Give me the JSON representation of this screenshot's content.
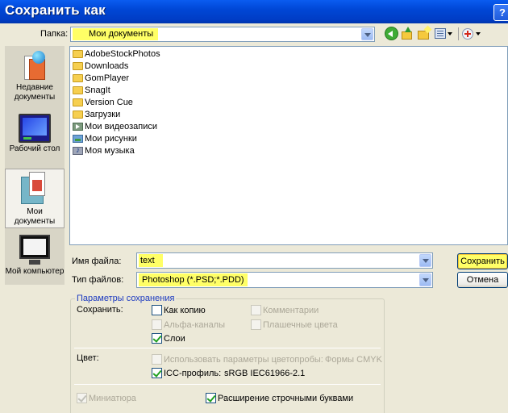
{
  "window": {
    "title": "Сохранить как",
    "help_glyph": "?"
  },
  "toolbar": {
    "folder_label": "Папка:",
    "current_folder": "Мои документы",
    "icons": [
      "back-icon",
      "up-folder-icon",
      "new-folder-icon",
      "views-menu-icon",
      "tools-menu-icon"
    ]
  },
  "places": [
    {
      "label": "Недавние документы",
      "icon": "recent-documents-icon"
    },
    {
      "label": "Рабочий стол",
      "icon": "desktop-icon"
    },
    {
      "label": "Мои документы",
      "icon": "my-documents-icon",
      "selected": true
    },
    {
      "label": "Мой компьютер",
      "icon": "my-computer-icon"
    }
  ],
  "files": [
    {
      "name": "AdobeStockPhotos",
      "icon": "folder-icon"
    },
    {
      "name": "Downloads",
      "icon": "folder-icon"
    },
    {
      "name": "GomPlayer",
      "icon": "folder-icon"
    },
    {
      "name": "SnagIt",
      "icon": "folder-icon"
    },
    {
      "name": "Version Cue",
      "icon": "folder-icon"
    },
    {
      "name": "Загрузки",
      "icon": "folder-icon"
    },
    {
      "name": "Мои видеозаписи",
      "icon": "videos-folder-icon"
    },
    {
      "name": "Мои рисунки",
      "icon": "pictures-folder-icon"
    },
    {
      "name": "Моя музыка",
      "icon": "music-folder-icon"
    }
  ],
  "form": {
    "filename_label": "Имя файла:",
    "filename_value": "text",
    "filetype_label": "Тип файлов:",
    "filetype_value": "Photoshop (*.PSD;*.PDD)",
    "save_button": "Сохранить",
    "cancel_button": "Отмена"
  },
  "options": {
    "group_title": "Параметры сохранения",
    "save_label": "Сохранить:",
    "as_copy": {
      "label": "Как копию",
      "checked": false,
      "enabled": true
    },
    "comments": {
      "label": "Комментарии",
      "checked": false,
      "enabled": false
    },
    "alpha_channels": {
      "label": "Альфа-каналы",
      "checked": false,
      "enabled": false
    },
    "spot_colors": {
      "label": "Плашечные цвета",
      "checked": false,
      "enabled": false
    },
    "layers": {
      "label": "Слои",
      "checked": true,
      "enabled": true
    },
    "color_label": "Цвет:",
    "use_proof_setup": {
      "label": "Использовать параметры цветопробы:",
      "value": "Формы CMYK",
      "checked": false,
      "enabled": false
    },
    "icc_profile": {
      "label": "ICC-профиль:",
      "value": "sRGB IEC61966-2.1",
      "checked": true,
      "enabled": true
    },
    "thumbnail": {
      "label": "Миниатюра",
      "checked": true,
      "enabled": false
    },
    "lowercase_ext": {
      "label": "Расширение строчными буквами",
      "checked": true,
      "enabled": true
    }
  },
  "colors": {
    "title_bar": "#0047d6",
    "highlight": "#ffff66",
    "dialog_bg": "#ece9d8"
  }
}
